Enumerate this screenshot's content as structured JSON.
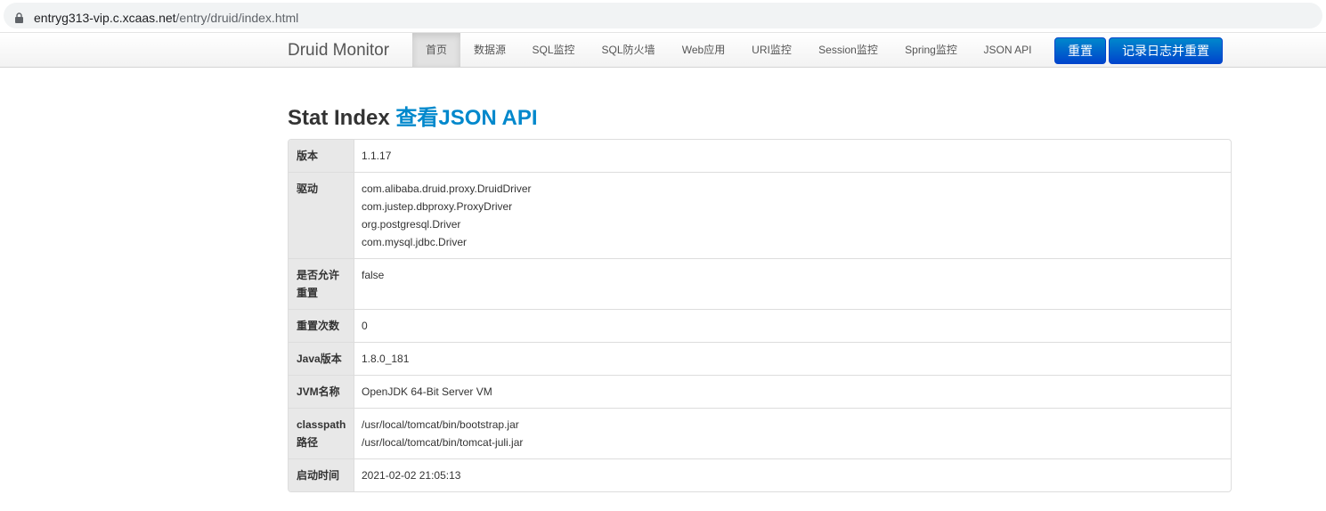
{
  "browser": {
    "url_host": "entryg313-vip.c.xcaas.net",
    "url_path": "/entry/druid/index.html"
  },
  "navbar": {
    "brand": "Druid Monitor",
    "items": [
      "首页",
      "数据源",
      "SQL监控",
      "SQL防火墙",
      "Web应用",
      "URI监控",
      "Session监控",
      "Spring监控",
      "JSON API"
    ],
    "active": "首页",
    "reset_button": "重置",
    "log_reset_button": "记录日志并重置"
  },
  "page": {
    "title": "Stat Index ",
    "title_link": "查看JSON API"
  },
  "stats": [
    {
      "label": "版本",
      "values": [
        "1.1.17"
      ]
    },
    {
      "label": "驱动",
      "values": [
        "com.alibaba.druid.proxy.DruidDriver",
        "com.justep.dbproxy.ProxyDriver",
        "org.postgresql.Driver",
        "com.mysql.jdbc.Driver"
      ]
    },
    {
      "label": "是否允许重置",
      "values": [
        "false"
      ]
    },
    {
      "label": "重置次数",
      "values": [
        "0"
      ]
    },
    {
      "label": "Java版本",
      "values": [
        "1.8.0_181"
      ]
    },
    {
      "label": "JVM名称",
      "values": [
        "OpenJDK 64-Bit Server VM"
      ]
    },
    {
      "label": "classpath路径",
      "values": [
        "/usr/local/tomcat/bin/bootstrap.jar",
        "/usr/local/tomcat/bin/tomcat-juli.jar"
      ]
    },
    {
      "label": "启动时间",
      "values": [
        "2021-02-02 21:05:13"
      ]
    }
  ],
  "colors": {
    "link": "#0088cc",
    "button": "#0055cc"
  }
}
